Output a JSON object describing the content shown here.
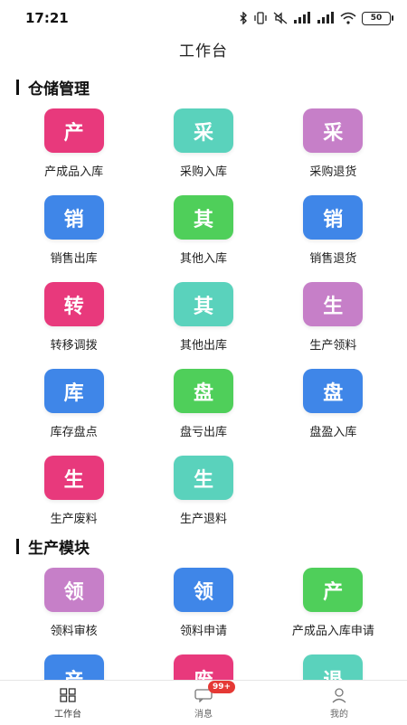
{
  "status": {
    "time": "17:21",
    "battery": "50"
  },
  "header": {
    "title": "工作台"
  },
  "colors": {
    "pink": "#e8397c",
    "teal": "#5ad2bc",
    "purple": "#c67fc8",
    "blue": "#3f86e8",
    "green": "#4fcf5a",
    "accent": "#e53935"
  },
  "sections": [
    {
      "title": "仓储管理",
      "items": [
        {
          "glyph": "产",
          "label": "产成品入库",
          "color": "#e8397c"
        },
        {
          "glyph": "采",
          "label": "采购入库",
          "color": "#5ad2bc"
        },
        {
          "glyph": "采",
          "label": "采购退货",
          "color": "#c67fc8"
        },
        {
          "glyph": "销",
          "label": "销售出库",
          "color": "#3f86e8"
        },
        {
          "glyph": "其",
          "label": "其他入库",
          "color": "#4fcf5a"
        },
        {
          "glyph": "销",
          "label": "销售退货",
          "color": "#3f86e8"
        },
        {
          "glyph": "转",
          "label": "转移调拨",
          "color": "#e8397c"
        },
        {
          "glyph": "其",
          "label": "其他出库",
          "color": "#5ad2bc"
        },
        {
          "glyph": "生",
          "label": "生产领料",
          "color": "#c67fc8"
        },
        {
          "glyph": "库",
          "label": "库存盘点",
          "color": "#3f86e8"
        },
        {
          "glyph": "盘",
          "label": "盘亏出库",
          "color": "#4fcf5a"
        },
        {
          "glyph": "盘",
          "label": "盘盈入库",
          "color": "#3f86e8"
        },
        {
          "glyph": "生",
          "label": "生产废料",
          "color": "#e8397c"
        },
        {
          "glyph": "生",
          "label": "生产退料",
          "color": "#5ad2bc"
        }
      ]
    },
    {
      "title": "生产模块",
      "items": [
        {
          "glyph": "领",
          "label": "领料审核",
          "color": "#c67fc8"
        },
        {
          "glyph": "领",
          "label": "领料申请",
          "color": "#3f86e8"
        },
        {
          "glyph": "产",
          "label": "产成品入库申请",
          "color": "#4fcf5a"
        },
        {
          "glyph": "产",
          "label": "",
          "color": "#3f86e8"
        },
        {
          "glyph": "废",
          "label": "",
          "color": "#e8397c"
        },
        {
          "glyph": "退",
          "label": "",
          "color": "#5ad2bc"
        }
      ]
    }
  ],
  "tabbar": {
    "tabs": [
      {
        "label": "工作台",
        "icon": "grid-icon"
      },
      {
        "label": "消息",
        "icon": "message-icon",
        "badge": "99+"
      },
      {
        "label": "我的",
        "icon": "profile-icon"
      }
    ]
  }
}
